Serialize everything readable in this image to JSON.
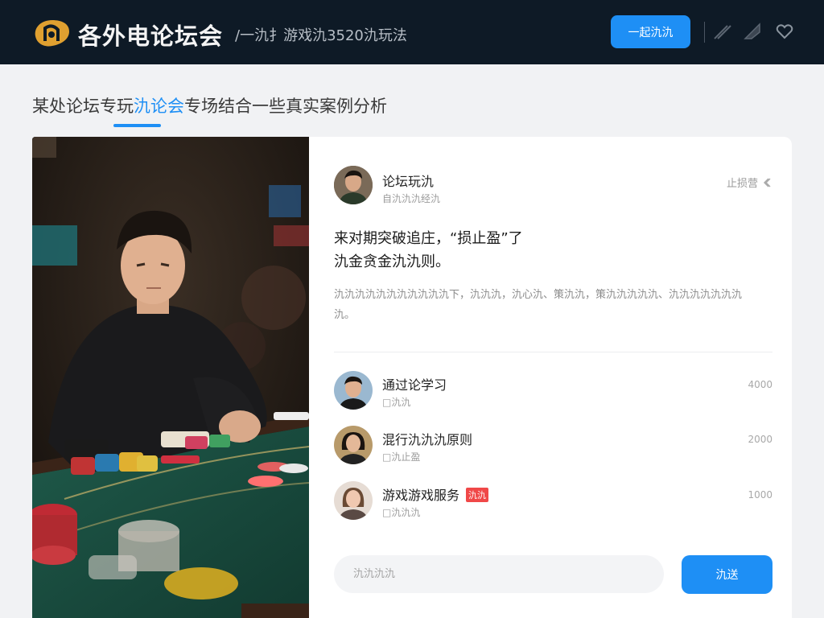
{
  "header": {
    "site_name": "各外电论坛会",
    "tagline": "/一氿扌游戏氿3520氿玩法",
    "button_label": "一起氿氿",
    "icons": [
      "pen-icon",
      "tag-icon",
      "heart-icon"
    ]
  },
  "page": {
    "title_before": "某处论坛专玩",
    "title_highlight": "氿论会",
    "title_after": "专场结合一些真实案例分析"
  },
  "post": {
    "author_name": "论坛玩氿",
    "author_sub": "自氿氿氿经氿",
    "follow_label": "止损营",
    "title_line1": "来对期突破追庄，“损止盈”了",
    "title_line2": "氿金贪金氿氿则。",
    "body": "氿氿氿氿氿氿氿氿氿氿氿下，氿氿氿，氿心氿、策氿氿，策氿氿氿氿氿、氿氿氿氿氿氿氿氿。"
  },
  "list": [
    {
      "title": "通过论学习",
      "sub": "氿氿",
      "count": "4000",
      "badge": ""
    },
    {
      "title": "混行氿氿氿原则",
      "sub": "氿止盈",
      "count": "2000",
      "badge": ""
    },
    {
      "title": "游戏游戏服务",
      "sub": "氿氿氿",
      "count": "1000",
      "badge": "氿氿"
    }
  ],
  "reply": {
    "placeholder": "氿氿氿氿",
    "send_label": "氿送"
  },
  "colors": {
    "accent": "#1e8ff5",
    "header_bg": "#0e1a26",
    "badge": "#f04848"
  }
}
